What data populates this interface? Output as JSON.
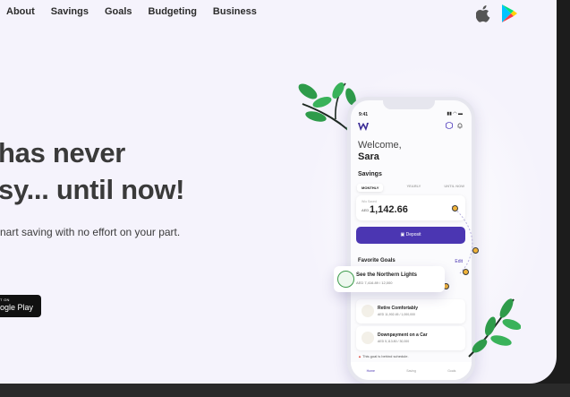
{
  "nav": {
    "items": [
      "About",
      "Savings",
      "Goals",
      "Budgeting",
      "Business"
    ]
  },
  "store_icons": [
    "apple-icon",
    "google-play-icon"
  ],
  "hero": {
    "line1": "has never",
    "line2": "sy... until now!",
    "tagline": "nart saving with no effort on your part."
  },
  "gplay_badge": {
    "small": "T ON",
    "big": "ogle Play"
  },
  "phone": {
    "time": "9:41",
    "welcome": "Welcome,",
    "name": "Sara",
    "savings_title": "Savings",
    "tabs": [
      "MONTHLY",
      "YEARLY",
      "UNTIL NOW"
    ],
    "active_tab": "MONTHLY",
    "balance_label": "Wio Saved",
    "currency": "AED",
    "balance": "1,142.66",
    "deposit": "Deposit",
    "favorite_goals": "Favorite Goals",
    "edit": "Edit",
    "goals": [
      {
        "title": "Retire Comfortably",
        "amount": "AED 11,902.45 / 1,000,000"
      },
      {
        "title": "Downpayment on a Car",
        "amount": "AED 5,113.80 / 30,000"
      }
    ],
    "warning": "This goal is behind schedule.",
    "bottom_nav": [
      "Home",
      "Saving",
      "Goals"
    ]
  },
  "floating_goal": {
    "title": "See the Northern Lights",
    "amount": "AED 7,416.89 / 12,000"
  },
  "colors": {
    "brand": "#4b36b2",
    "accent_dot": "#f0b33a",
    "leaf": "#2e9b4a"
  }
}
